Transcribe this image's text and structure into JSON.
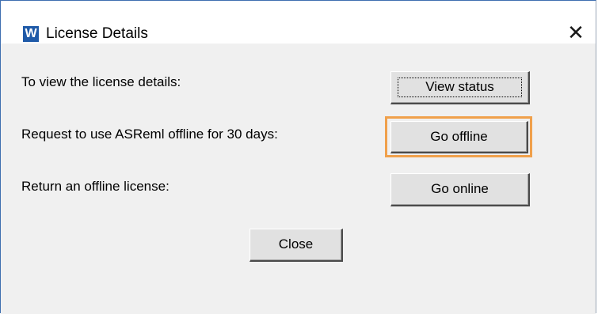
{
  "window": {
    "title": "License Details",
    "app_icon_letter": "W",
    "close_glyph": "✕"
  },
  "rows": [
    {
      "label": "To view the license details:",
      "button": "View status"
    },
    {
      "label": "Request to use ASReml offline for 30 days:",
      "button": "Go offline"
    },
    {
      "label": "Return an offline license:",
      "button": "Go online"
    }
  ],
  "footer": {
    "close_label": "Close"
  },
  "colors": {
    "highlight": "#f0a04b",
    "app_icon_bg": "#1f5aa8",
    "dialog_bg": "#f0f0f0"
  },
  "icons": {
    "app": "word-app-icon",
    "close": "close-icon"
  }
}
